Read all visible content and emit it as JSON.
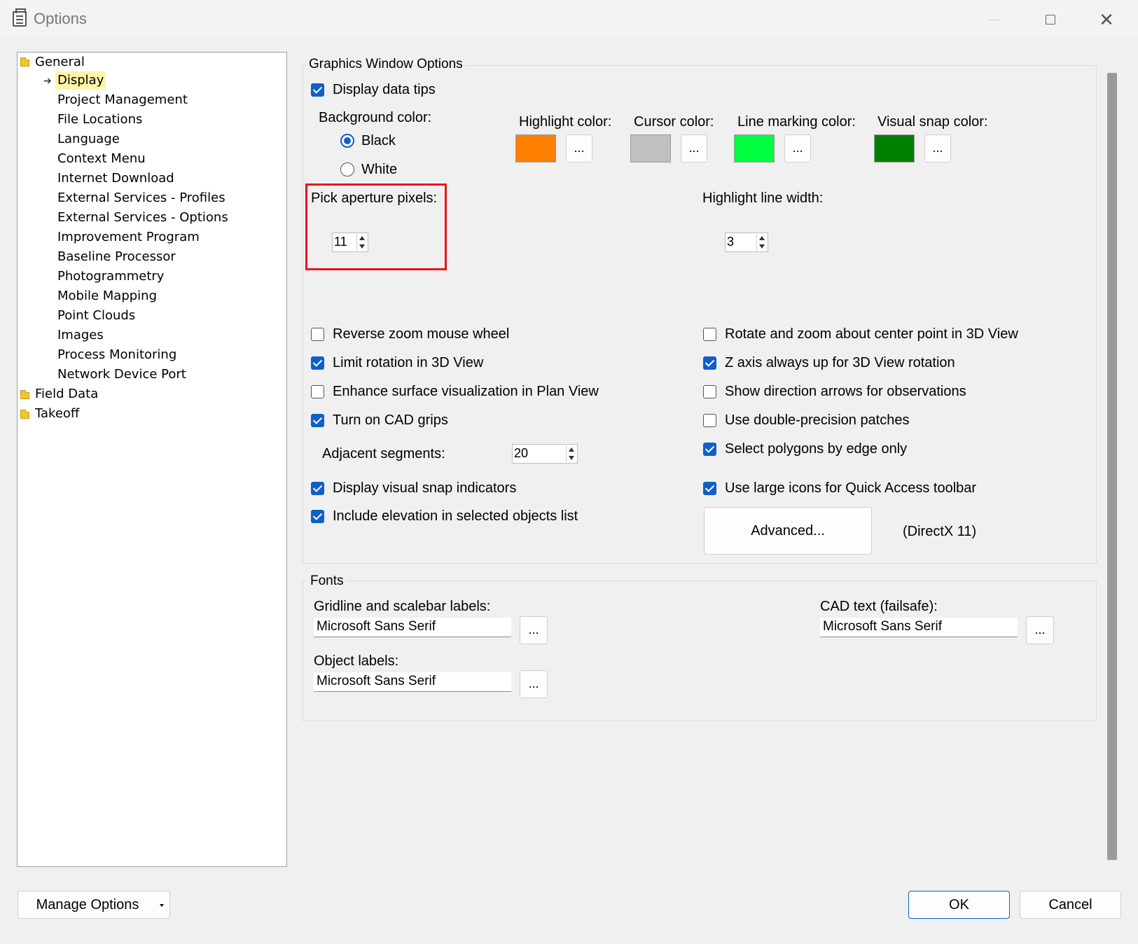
{
  "window": {
    "title": "Options"
  },
  "tree": {
    "items": [
      {
        "label": "General",
        "type": "folder"
      },
      {
        "label": "Display",
        "type": "child",
        "selected": true
      },
      {
        "label": "Project Management",
        "type": "child"
      },
      {
        "label": "File Locations",
        "type": "child"
      },
      {
        "label": "Language",
        "type": "child"
      },
      {
        "label": "Context Menu",
        "type": "child"
      },
      {
        "label": "Internet Download",
        "type": "child"
      },
      {
        "label": "External Services - Profiles",
        "type": "child"
      },
      {
        "label": "External Services - Options",
        "type": "child"
      },
      {
        "label": "Improvement Program",
        "type": "child"
      },
      {
        "label": "Baseline Processor",
        "type": "child"
      },
      {
        "label": "Photogrammetry",
        "type": "child"
      },
      {
        "label": "Mobile Mapping",
        "type": "child"
      },
      {
        "label": "Point Clouds",
        "type": "child"
      },
      {
        "label": "Images",
        "type": "child"
      },
      {
        "label": "Process Monitoring",
        "type": "child"
      },
      {
        "label": "Network Device Port",
        "type": "child"
      },
      {
        "label": "Field Data",
        "type": "folder"
      },
      {
        "label": "Takeoff",
        "type": "folder"
      }
    ]
  },
  "graphics": {
    "legend": "Graphics Window Options",
    "display_data_tips": {
      "label": "Display data tips",
      "checked": true
    },
    "background": {
      "label": "Background color:",
      "black": {
        "label": "Black",
        "selected": true
      },
      "white": {
        "label": "White",
        "selected": false
      }
    },
    "colors": {
      "highlight": {
        "label": "Highlight color:",
        "value": "#ff8000"
      },
      "cursor": {
        "label": "Cursor color:",
        "value": "#c0c0c0"
      },
      "line_marking": {
        "label": "Line marking color:",
        "value": "#00ff40"
      },
      "visual_snap": {
        "label": "Visual snap color:",
        "value": "#008000"
      },
      "picker_label": "..."
    },
    "pick_aperture": {
      "label": "Pick aperture pixels:",
      "value": "11"
    },
    "highlight_line_width": {
      "label": "Highlight line width:",
      "value": "3"
    },
    "left_options": {
      "reverse_zoom": {
        "label": "Reverse zoom mouse wheel",
        "checked": false
      },
      "limit_rotation": {
        "label": "Limit rotation in 3D View",
        "checked": true
      },
      "enhance_surface": {
        "label": "Enhance surface visualization in Plan View",
        "checked": false
      },
      "cad_grips": {
        "label": "Turn on CAD grips",
        "checked": true
      },
      "adjacent_segments": {
        "label": "Adjacent segments:",
        "value": "20"
      },
      "visual_snap": {
        "label": "Display visual snap indicators",
        "checked": true
      },
      "include_elevation": {
        "label": "Include elevation in selected objects list",
        "checked": true
      }
    },
    "right_options": {
      "rotate_zoom_center": {
        "label": "Rotate and zoom about center point in 3D View",
        "checked": false
      },
      "z_axis_up": {
        "label": "Z axis always up for 3D View rotation",
        "checked": true
      },
      "direction_arrows": {
        "label": "Show direction arrows for observations",
        "checked": false
      },
      "double_precision": {
        "label": "Use double-precision patches",
        "checked": false
      },
      "polygons_edge": {
        "label": "Select polygons by edge only",
        "checked": true
      },
      "large_icons": {
        "label": "Use large icons for Quick Access toolbar",
        "checked": true
      }
    },
    "advanced_button": "Advanced...",
    "directx": "(DirectX 11)"
  },
  "fonts": {
    "legend": "Fonts",
    "gridline": {
      "label": "Gridline and scalebar labels:",
      "value": "Microsoft Sans Serif"
    },
    "object": {
      "label": "Object labels:",
      "value": "Microsoft Sans Serif"
    },
    "cad": {
      "label": "CAD text (failsafe):",
      "value": "Microsoft Sans Serif"
    },
    "picker_label": "..."
  },
  "footer": {
    "manage_options": "Manage Options",
    "ok": "OK",
    "cancel": "Cancel"
  }
}
